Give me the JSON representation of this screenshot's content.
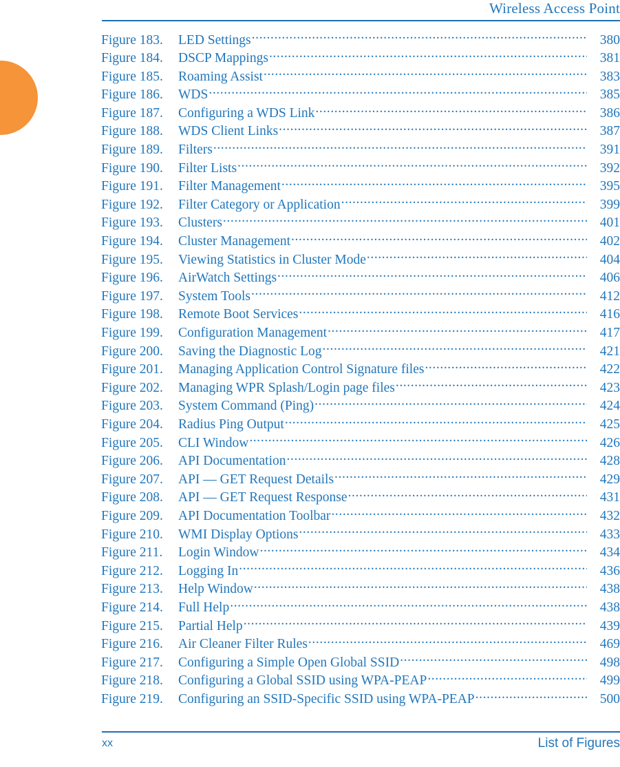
{
  "header": {
    "title": "Wireless Access Point"
  },
  "footer": {
    "page_number": "xx",
    "section": "List of Figures"
  },
  "colors": {
    "accent_blue": "#2277BB",
    "rule_blue": "#1E6FB4",
    "tab_orange": "#F59438"
  },
  "toc": {
    "entries": [
      {
        "label": "Figure 183.",
        "title": "LED Settings",
        "page": "380"
      },
      {
        "label": "Figure 184.",
        "title": "DSCP Mappings",
        "page": "381"
      },
      {
        "label": "Figure 185.",
        "title": "Roaming Assist",
        "page": "383"
      },
      {
        "label": "Figure 186.",
        "title": "WDS",
        "page": "385"
      },
      {
        "label": "Figure 187.",
        "title": "Configuring a WDS Link",
        "page": "386"
      },
      {
        "label": "Figure 188.",
        "title": "WDS Client Links",
        "page": "387"
      },
      {
        "label": "Figure 189.",
        "title": "Filters",
        "page": "391"
      },
      {
        "label": "Figure 190.",
        "title": "Filter Lists",
        "page": "392"
      },
      {
        "label": "Figure 191.",
        "title": "Filter Management",
        "page": "395"
      },
      {
        "label": "Figure 192.",
        "title": "Filter Category or Application",
        "page": "399"
      },
      {
        "label": "Figure 193.",
        "title": "Clusters",
        "page": "401"
      },
      {
        "label": "Figure 194.",
        "title": "Cluster Management",
        "page": "402"
      },
      {
        "label": "Figure 195.",
        "title": "Viewing Statistics in Cluster Mode",
        "page": "404"
      },
      {
        "label": "Figure 196.",
        "title": "AirWatch Settings",
        "page": "406"
      },
      {
        "label": "Figure 197.",
        "title": "System Tools",
        "page": "412"
      },
      {
        "label": "Figure 198.",
        "title": "Remote Boot Services",
        "page": "416"
      },
      {
        "label": "Figure 199.",
        "title": "Configuration Management",
        "page": "417"
      },
      {
        "label": "Figure 200.",
        "title": "Saving the Diagnostic Log",
        "page": "421"
      },
      {
        "label": "Figure 201.",
        "title": "Managing Application Control Signature files",
        "page": "422"
      },
      {
        "label": "Figure 202.",
        "title": "Managing WPR Splash/Login page files",
        "page": "423"
      },
      {
        "label": "Figure 203.",
        "title": "System Command (Ping)",
        "page": "424"
      },
      {
        "label": "Figure 204.",
        "title": "Radius Ping Output",
        "page": "425"
      },
      {
        "label": "Figure 205.",
        "title": "CLI Window",
        "page": "426"
      },
      {
        "label": "Figure 206.",
        "title": "API Documentation",
        "page": "428"
      },
      {
        "label": "Figure 207.",
        "title": "API — GET Request Details",
        "page": "429"
      },
      {
        "label": "Figure 208.",
        "title": "API — GET Request Response",
        "page": "431"
      },
      {
        "label": "Figure 209.",
        "title": "API Documentation Toolbar",
        "page": "432"
      },
      {
        "label": "Figure 210.",
        "title": "WMI Display Options",
        "page": "433"
      },
      {
        "label": "Figure 211.",
        "title": "Login Window",
        "page": "434"
      },
      {
        "label": "Figure 212.",
        "title": "Logging In",
        "page": "436"
      },
      {
        "label": "Figure 213.",
        "title": "Help Window",
        "page": "438"
      },
      {
        "label": "Figure 214.",
        "title": "Full Help",
        "page": "438"
      },
      {
        "label": "Figure 215.",
        "title": "Partial Help",
        "page": "439"
      },
      {
        "label": "Figure 216.",
        "title": "Air Cleaner Filter Rules",
        "page": "469"
      },
      {
        "label": "Figure 217.",
        "title": "Configuring a Simple Open Global SSID",
        "page": "498"
      },
      {
        "label": "Figure 218.",
        "title": "Configuring a Global SSID using WPA-PEAP",
        "page": "499"
      },
      {
        "label": "Figure 219.",
        "title": "Configuring an SSID-Specific SSID using WPA-PEAP",
        "page": "500"
      }
    ]
  }
}
